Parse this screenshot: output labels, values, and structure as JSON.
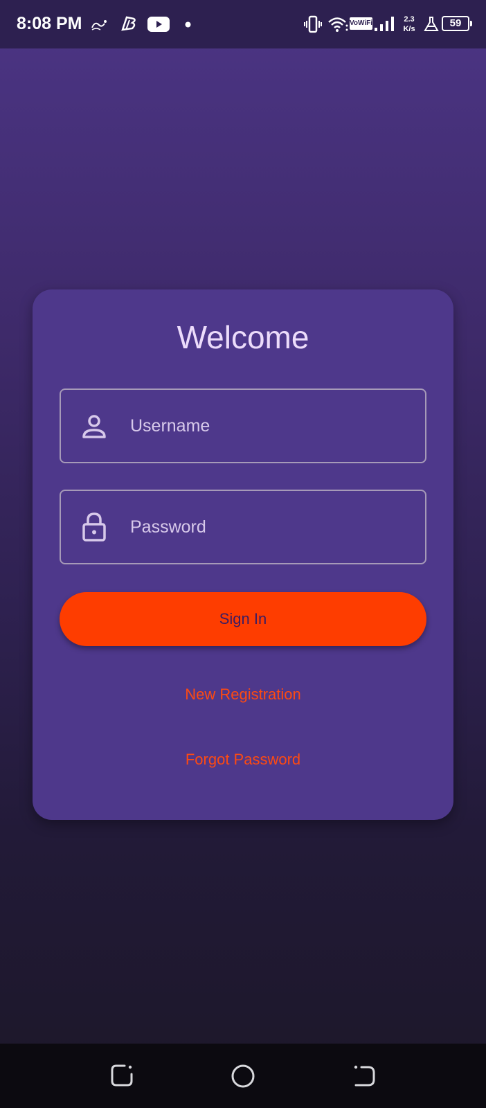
{
  "status_bar": {
    "time": "8:08 PM",
    "vowifi": "VoWiFi",
    "speed_value": "2.3",
    "speed_unit": "K/s",
    "battery": "59",
    "icons": [
      "carrier-icon",
      "bank-icon",
      "youtube-icon",
      "dot-icon",
      "vibrate-icon",
      "wifi-icon",
      "signal-icon",
      "flask-icon",
      "battery-icon"
    ]
  },
  "login": {
    "title": "Welcome",
    "username_placeholder": "Username",
    "password_placeholder": "Password",
    "sign_in_label": "Sign In",
    "register_label": "New Registration",
    "forgot_label": "Forgot Password"
  },
  "nav_bar": {
    "icons": [
      "recents-icon",
      "home-icon",
      "back-icon"
    ]
  },
  "colors": {
    "accent": "#fe3d00",
    "card": "#4e388b",
    "link": "#fd4a12",
    "title": "#ecdcfb"
  }
}
